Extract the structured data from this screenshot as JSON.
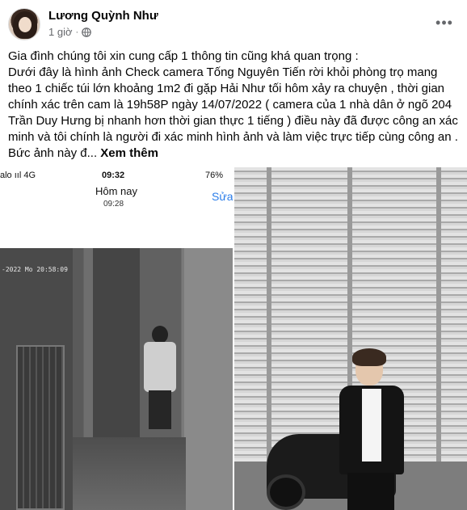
{
  "post": {
    "author": "Lương Quỳnh Như",
    "time": "1 giờ",
    "separator": "·",
    "more_icon": "more-horizontal-icon",
    "text_lines": [
      "Gia đình chúng tôi xin cung cấp 1 thông tin cũng khá quan trọng :",
      "Dưới đây là hình ảnh Check camera Tống Nguyên Tiến rời khỏi phòng trọ mang",
      "theo 1 chiếc túi lớn khoảng 1m2 đi gặp Hải Như tối hôm xảy ra chuyện  , thời gian",
      "chính xác trên cam là 19h58P ngày 14/07/2022 ( camera của 1 nhà dân ở ngõ 204",
      "Trần Duy Hưng bị nhanh hơn thời gian thực 1 tiếng ) điều này đã được công an xác",
      "minh và tôi chính là người đi xác minh hình ảnh và làm việc trực tiếp cùng công an .",
      "Bức ảnh này đ..."
    ],
    "see_more": "Xem thêm"
  },
  "photo_left": {
    "status_left": "alo ııl 4G",
    "status_time": "09:32",
    "status_battery": "76%",
    "title": "Hôm nay",
    "subtitle": "09:28",
    "action": "Sửa",
    "cctv_stamp": "-2022 Mo 20:58:09"
  },
  "colors": {
    "text": "#050505",
    "secondary": "#65676b",
    "link": "#2b7de9"
  }
}
